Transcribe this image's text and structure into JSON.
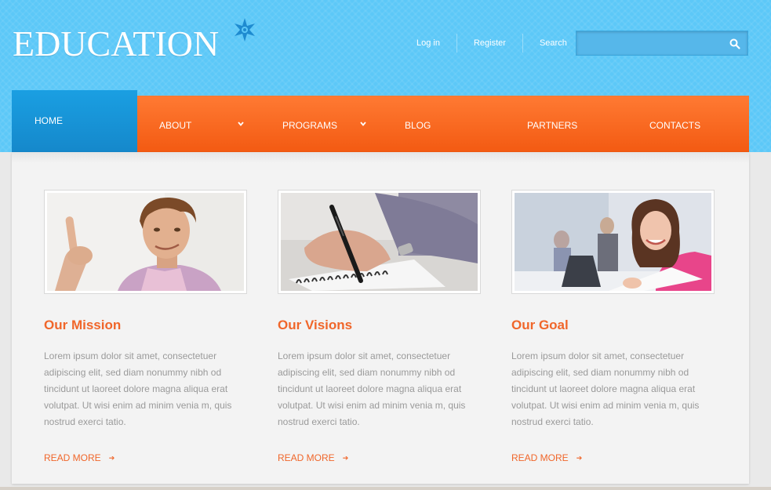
{
  "brand": {
    "logo_text": "EDUCATION",
    "accent": "#f0662a",
    "header_bg": "#5cc8f8"
  },
  "topbar": {
    "login": "Log in",
    "register": "Register",
    "search_label": "Search",
    "search_value": ""
  },
  "nav": {
    "home": "HOME",
    "about": "ABOUT",
    "programs": "PROGRAMS",
    "blog": "BLOG",
    "partners": "PARTNERS",
    "contacts": "CONTACTS",
    "active_color": "#1a9fe2",
    "bar_color": "#f35a12"
  },
  "columns": [
    {
      "title": "Our Mission",
      "text": "Lorem ipsum dolor sit amet, consectetuer adipiscing elit, sed diam nonummy nibh od tincidunt ut laoreet dolore magna aliqua erat volutpat. Ut wisi enim ad minim venia m, quis nostrud exerci tatio.",
      "read_more": "READ MORE",
      "image": "man-pointing-up-photo"
    },
    {
      "title": "Our Visions",
      "text": "Lorem ipsum dolor sit amet, consectetuer adipiscing elit, sed diam nonummy nibh od tincidunt ut laoreet dolore magna aliqua erat volutpat. Ut wisi enim ad minim venia m, quis nostrud exerci tatio.",
      "read_more": "READ MORE",
      "image": "hand-writing-notebook-photo"
    },
    {
      "title": "Our Goal",
      "text": "Lorem ipsum dolor sit amet, consectetuer adipiscing elit, sed diam nonummy nibh od tincidunt ut laoreet dolore magna aliqua erat volutpat. Ut wisi enim ad minim venia m, quis nostrud exerci tatio.",
      "read_more": "READ MORE",
      "image": "student-reading-photo"
    }
  ]
}
